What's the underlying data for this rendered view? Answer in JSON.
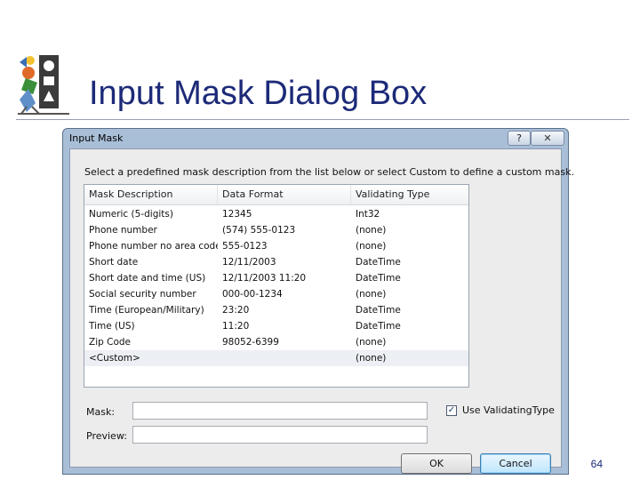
{
  "slide": {
    "title": "Input Mask Dialog Box",
    "page_number": "64"
  },
  "dialog": {
    "title": "Input Mask",
    "help_label": "?",
    "close_label": "✕",
    "instruction": "Select a predefined mask description from the list below or select Custom to define a custom mask.",
    "columns": [
      "Mask Description",
      "Data Format",
      "Validating Type"
    ],
    "rows": [
      [
        "Numeric (5-digits)",
        "12345",
        "Int32"
      ],
      [
        "Phone number",
        "(574) 555-0123",
        "(none)"
      ],
      [
        "Phone number no area code",
        "555-0123",
        "(none)"
      ],
      [
        "Short date",
        "12/11/2003",
        "DateTime"
      ],
      [
        "Short date and time (US)",
        "12/11/2003 11:20",
        "DateTime"
      ],
      [
        "Social security number",
        "000-00-1234",
        "(none)"
      ],
      [
        "Time (European/Military)",
        "23:20",
        "DateTime"
      ],
      [
        "Time (US)",
        "11:20",
        "DateTime"
      ],
      [
        "Zip Code",
        "98052-6399",
        "(none)"
      ],
      [
        "<Custom>",
        "",
        "(none)"
      ]
    ],
    "selected_row": "<Custom>",
    "mask_label": "Mask:",
    "mask_value": "",
    "preview_label": "Preview:",
    "preview_value": "",
    "use_validating_type_label": "Use ValidatingType",
    "use_validating_type_checked": true,
    "ok_label": "OK",
    "cancel_label": "Cancel"
  },
  "colors": {
    "title": "#1c2a78",
    "window_frame": "#a9bfd8",
    "client_background": "#ececec"
  }
}
